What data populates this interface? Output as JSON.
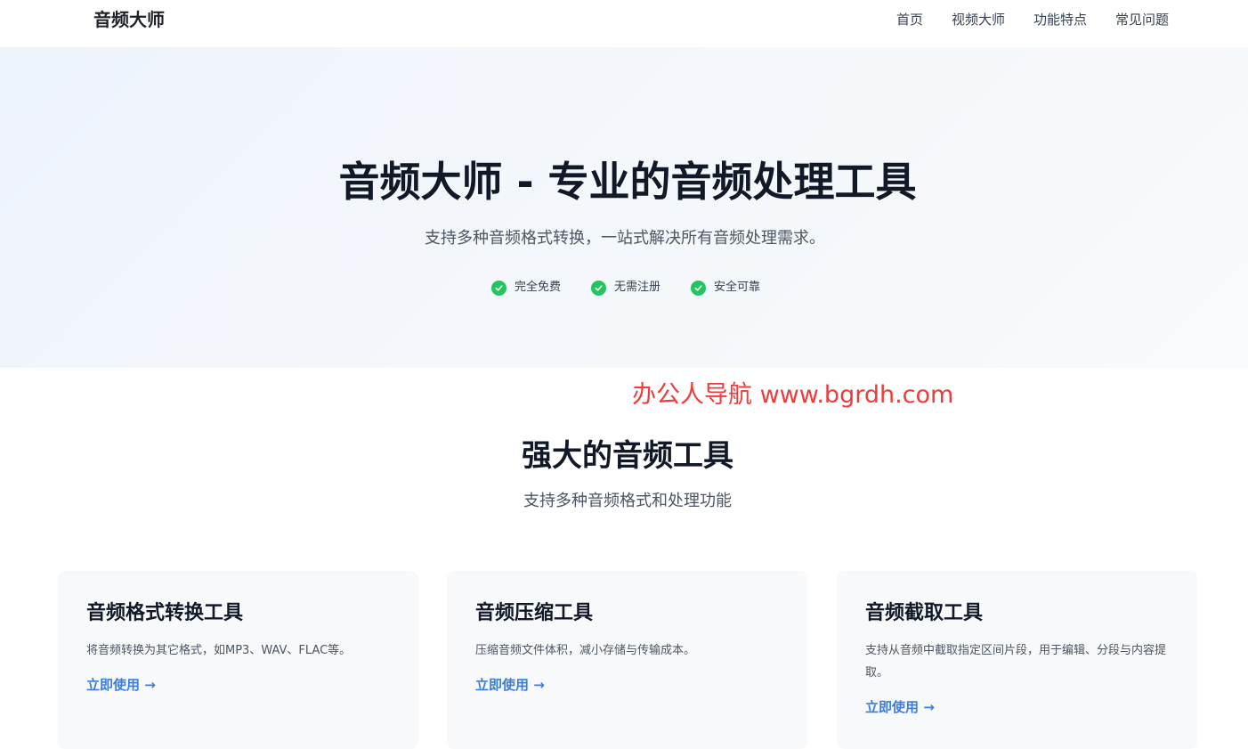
{
  "header": {
    "logo": "音频大师",
    "nav": [
      "首页",
      "视频大师",
      "功能特点",
      "常见问题"
    ]
  },
  "hero": {
    "title": "音频大师 - 专业的音频处理工具",
    "subtitle": "支持多种音频格式转换，一站式解决所有音频处理需求。",
    "features": [
      "完全免费",
      "无需注册",
      "安全可靠"
    ]
  },
  "watermark": "办公人导航  www.bgrdh.com",
  "tools": {
    "title": "强大的音频工具",
    "subtitle": "支持多种音频格式和处理功能",
    "cards": [
      {
        "title": "音频格式转换工具",
        "desc": "将音频转换为其它格式，如MP3、WAV、FLAC等。",
        "link": "立即使用 →"
      },
      {
        "title": "音频压缩工具",
        "desc": "压缩音频文件体积，减小存储与传输成本。",
        "link": "立即使用 →"
      },
      {
        "title": "音频截取工具",
        "desc": "支持从音频中截取指定区间片段，用于编辑、分段与内容提取。",
        "link": "立即使用 →"
      }
    ]
  },
  "colors": {
    "accent": "#3b7ddd",
    "check": "#22c55e",
    "watermark": "#ef3b3b"
  }
}
